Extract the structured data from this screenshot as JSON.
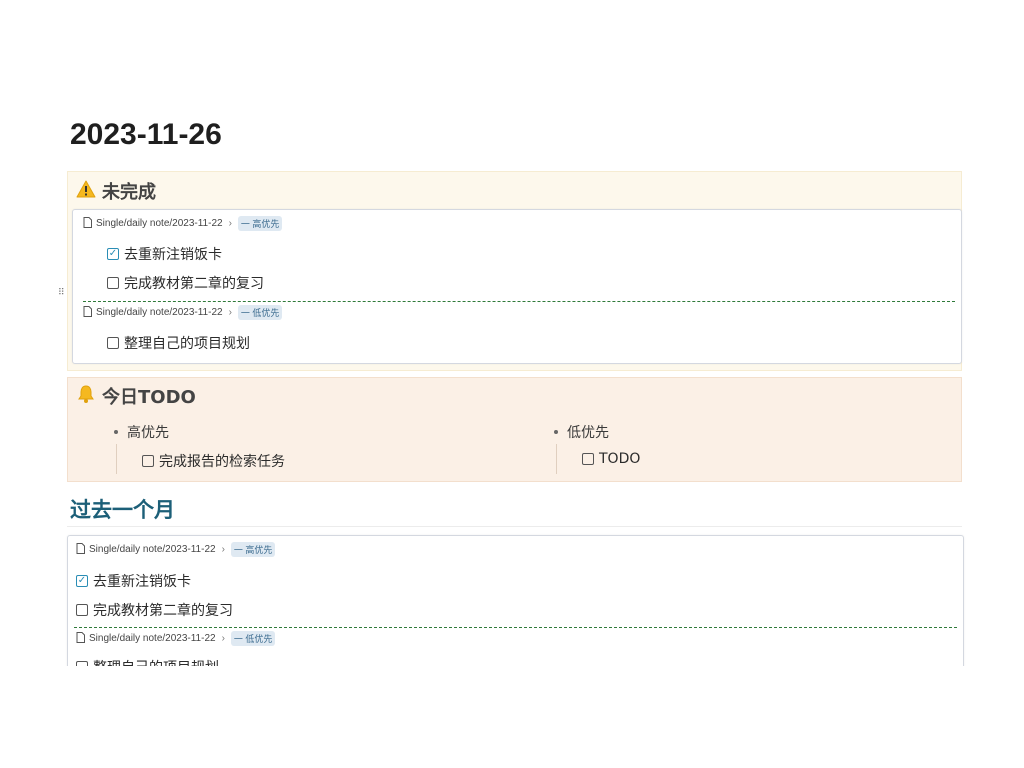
{
  "page": {
    "title": "2023-11-26"
  },
  "icons": {
    "warning": "warning-icon",
    "bell": "bell-icon",
    "file": "file-icon"
  },
  "colors": {
    "warning_bg": "#fdf8ec",
    "todo_bg": "#fbf0e6",
    "accent": "#2a8db5",
    "divider": "#2f7a3a",
    "section_title": "#1c5f78"
  },
  "callout_incomplete": {
    "title": "未完成",
    "groups": [
      {
        "source": "Single/daily note/2023-11-22",
        "tag": "一 高优先",
        "tasks": [
          {
            "text": "去重新注销饭卡",
            "checked": true
          },
          {
            "text": "完成教材第二章的复习",
            "checked": false
          }
        ]
      },
      {
        "source": "Single/daily note/2023-11-22",
        "tag": "一 低优先",
        "tasks": [
          {
            "text": "整理自己的项目规划",
            "checked": false
          }
        ]
      }
    ]
  },
  "callout_todo": {
    "title": "今日TODO",
    "columns": [
      {
        "label": "高优先",
        "task": "完成报告的检索任务"
      },
      {
        "label": "低优先",
        "task": "TODO"
      }
    ]
  },
  "past_month": {
    "title": "过去一个月",
    "groups": [
      {
        "source": "Single/daily note/2023-11-22",
        "tag": "一 高优先",
        "tasks": [
          {
            "text": "去重新注销饭卡",
            "checked": true
          },
          {
            "text": "完成教材第二章的复习",
            "checked": false
          }
        ]
      },
      {
        "source": "Single/daily note/2023-11-22",
        "tag": "一 低优先",
        "tasks": [
          {
            "text": "整理自己的项目规划",
            "checked": false
          }
        ]
      }
    ]
  }
}
